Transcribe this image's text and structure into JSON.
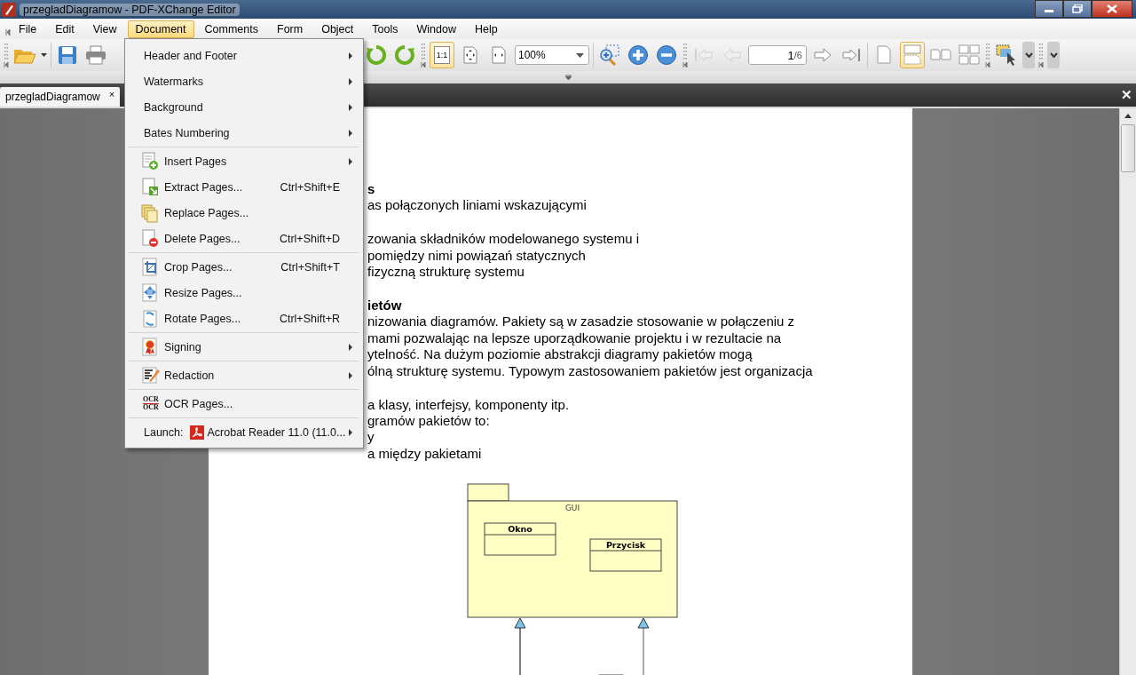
{
  "window": {
    "title": "przegladDiagramow - PDF-XChange Editor"
  },
  "menubar": [
    {
      "label": "File",
      "selected": false
    },
    {
      "label": "Edit",
      "selected": false
    },
    {
      "label": "View",
      "selected": false
    },
    {
      "label": "Document",
      "selected": true
    },
    {
      "label": "Comments",
      "selected": false
    },
    {
      "label": "Form",
      "selected": false
    },
    {
      "label": "Object",
      "selected": false
    },
    {
      "label": "Tools",
      "selected": false
    },
    {
      "label": "Window",
      "selected": false
    },
    {
      "label": "Help",
      "selected": false
    }
  ],
  "toolbar": {
    "view_modes": [
      {
        "kind": "actual-size",
        "label": "1:1",
        "selected": true
      },
      {
        "kind": "fit-page",
        "selected": false
      },
      {
        "kind": "fit-width",
        "selected": false
      }
    ],
    "zoom": "100%",
    "nav": [
      {
        "kind": "first",
        "disabled": true
      },
      {
        "kind": "prev",
        "disabled": true
      }
    ],
    "page": "1",
    "page_total": "/6",
    "nav_after": [
      {
        "kind": "next",
        "disabled": false
      },
      {
        "kind": "last",
        "disabled": false
      }
    ],
    "layouts": [
      {
        "kind": "single",
        "selected": false
      },
      {
        "kind": "continuous",
        "selected": true
      },
      {
        "kind": "facing",
        "selected": false
      },
      {
        "kind": "facing-continuous",
        "selected": false
      }
    ]
  },
  "tabs": [
    {
      "label": "przegladDiagramow",
      "close": "×",
      "selected": true
    }
  ],
  "tabbar_close": "✕",
  "document_menu": {
    "groups": [
      [
        {
          "kind": "plain",
          "label": "Header and Footer",
          "submenu": true
        },
        {
          "kind": "plain",
          "label": "Watermarks",
          "submenu": true
        },
        {
          "kind": "plain",
          "label": "Background",
          "submenu": true
        },
        {
          "kind": "plain",
          "label": "Bates Numbering",
          "submenu": true
        }
      ],
      [
        {
          "kind": "icon",
          "label": "Insert Pages",
          "submenu": true
        },
        {
          "kind": "icon",
          "label": "Extract Pages...",
          "shortcut": "Ctrl+Shift+E",
          "submenu": false
        },
        {
          "kind": "icon",
          "label": "Replace Pages...",
          "submenu": false
        },
        {
          "kind": "icon",
          "label": "Delete Pages...",
          "shortcut": "Ctrl+Shift+D",
          "submenu": false
        }
      ],
      [
        {
          "kind": "icon",
          "label": "Crop Pages...",
          "shortcut": "Ctrl+Shift+T",
          "submenu": false
        },
        {
          "kind": "icon",
          "label": "Resize Pages...",
          "submenu": false
        },
        {
          "kind": "icon",
          "label": "Rotate Pages...",
          "shortcut": "Ctrl+Shift+R",
          "submenu": false
        }
      ],
      [
        {
          "kind": "icon",
          "label": "Signing",
          "submenu": true
        }
      ],
      [
        {
          "kind": "icon",
          "label": "Redaction",
          "submenu": true
        }
      ],
      [
        {
          "kind": "ocr",
          "label": "OCR Pages...",
          "icon_lines": [
            "OCR",
            "OCR"
          ],
          "submenu": false
        }
      ],
      [
        {
          "kind": "launch",
          "prefix": "Launch:",
          "label": "Acrobat Reader 11.0 (11.0...",
          "submenu": true
        }
      ]
    ]
  },
  "document": {
    "blocks": [
      {
        "lines": [
          {
            "kind": "heading",
            "text": "s"
          },
          {
            "kind": "text",
            "text": "as połączonych liniami wskazującymi"
          }
        ]
      },
      {
        "lines": [
          {
            "kind": "text",
            "text": "zowania składników modelowanego systemu i"
          },
          {
            "kind": "text",
            "text": "pomiędzy nimi powiązań statycznych"
          },
          {
            "kind": "text",
            "text": "fizyczną strukturę systemu"
          }
        ]
      },
      {
        "lines": [
          {
            "kind": "heading",
            "text": "ietów"
          },
          {
            "kind": "text",
            "text": "nizowania diagramów. Pakiety są w zasadzie stosowanie w połączeniu z"
          },
          {
            "kind": "text",
            "text": "mami pozwalając na lepsze uporządkowanie projektu i w rezultacie na"
          },
          {
            "kind": "text",
            "text": "ytelność. Na dużym poziomie abstrakcji diagramy pakietów mogą"
          },
          {
            "kind": "text",
            "text": "ólną strukturę systemu. Typowym zastosowaniem pakietów jest organizacja"
          }
        ]
      },
      {
        "lines": [
          {
            "kind": "text",
            "text": "a klasy, interfejsy, komponenty itp."
          },
          {
            "kind": "text",
            "text": "gramów pakietów to:"
          },
          {
            "kind": "text",
            "text": "y"
          },
          {
            "kind": "text",
            "text": "a między pakietami"
          }
        ]
      }
    ],
    "diagram": {
      "package": "GUI",
      "classes": [
        "Okno",
        "Przycisk"
      ]
    }
  }
}
